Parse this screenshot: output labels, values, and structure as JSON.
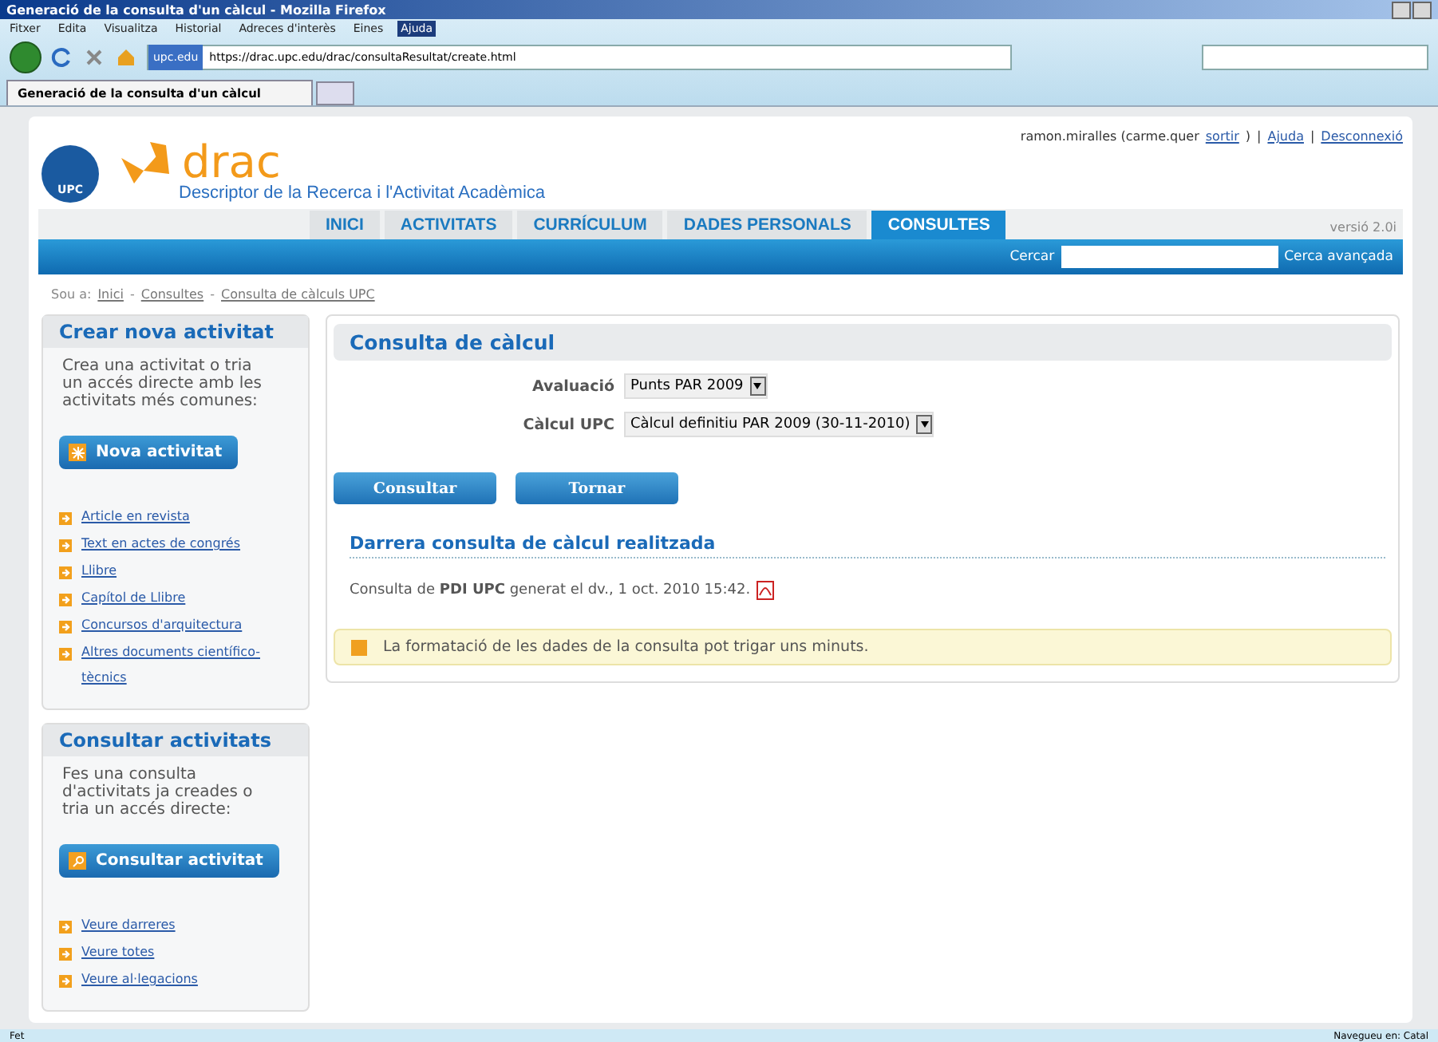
{
  "window": {
    "title": "Generació de la consulta d'un càlcul - Mozilla Firefox"
  },
  "menu": [
    {
      "label": "Fitxer",
      "selected": false
    },
    {
      "label": "Edita",
      "selected": false
    },
    {
      "label": "Visualitza",
      "selected": false
    },
    {
      "label": "Historial",
      "selected": false
    },
    {
      "label": "Adreces d'interès",
      "selected": false
    },
    {
      "label": "Eines",
      "selected": false
    },
    {
      "label": "Ajuda",
      "selected": true
    }
  ],
  "address_bar": {
    "site": "upc.edu",
    "url": "https://drac.upc.edu/drac/consultaResultat/create.html"
  },
  "browser_tabs": [
    {
      "label": "Generació de la consulta d'un càlcul",
      "selected": true
    }
  ],
  "header": {
    "logo_text": "UPC",
    "brand": "drac",
    "subtitle": "Descriptor de la Recerca i l'Activitat Acadèmica",
    "user": "ramon.miralles (carme.quer",
    "logout_inline": "sortir",
    "user_end": ")",
    "links": [
      "Ajuda",
      "Desconnexió"
    ],
    "separators": [
      "|",
      "|"
    ]
  },
  "nav_tabs": [
    {
      "label": "INICI",
      "selected": false
    },
    {
      "label": "ACTIVITATS",
      "selected": false
    },
    {
      "label": "CURRÍCULUM",
      "selected": false
    },
    {
      "label": "DADES PERSONALS",
      "selected": false
    },
    {
      "label": "CONSULTES",
      "selected": true
    }
  ],
  "version": "versió 2.0i",
  "search": {
    "label": "Cercar",
    "advanced": "Cerca avançada"
  },
  "breadcrumb": {
    "prefix": "Sou a:",
    "items": [
      "Inici",
      "Consultes",
      "Consulta de càlculs UPC"
    ],
    "separators": [
      "-",
      "-"
    ]
  },
  "sidebar": [
    {
      "title": "Crear nova activitat",
      "text": "Crea una activitat o tria un accés directe amb les activitats més comunes:",
      "button": "Nova activitat",
      "kind": "new",
      "links": [
        "Article en revista",
        "Text en actes de congrés",
        "Llibre",
        "Capítol de Llibre",
        "Concursos d'arquitectura",
        "Altres documents científico-tècnics"
      ]
    },
    {
      "title": "Consultar activitats",
      "text": "Fes una consulta d'activitats ja creades o tria un accés directe:",
      "button": "Consultar activitat",
      "kind": "search",
      "links": [
        "Veure darreres",
        "Veure totes",
        "Veure al·legacions"
      ]
    }
  ],
  "main": {
    "title": "Consulta de càlcul",
    "fields": [
      {
        "label": "Avaluació",
        "value": "Punts PAR 2009"
      },
      {
        "label": "Càlcul UPC",
        "value": "Càlcul definitiu PAR 2009 (30-11-2010)"
      }
    ],
    "buttons": [
      "Consultar",
      "Tornar"
    ],
    "last_title": "Darrera consulta de càlcul realitzada",
    "last_text": "Consulta de **PDI UPC** generat el dv., 1 oct. 2010 15:42.",
    "notice": "La formatació de les dades de la consulta pot trigar uns minuts."
  },
  "status_bar": {
    "left": "Fet",
    "right": "Navegueu en: Catal"
  }
}
